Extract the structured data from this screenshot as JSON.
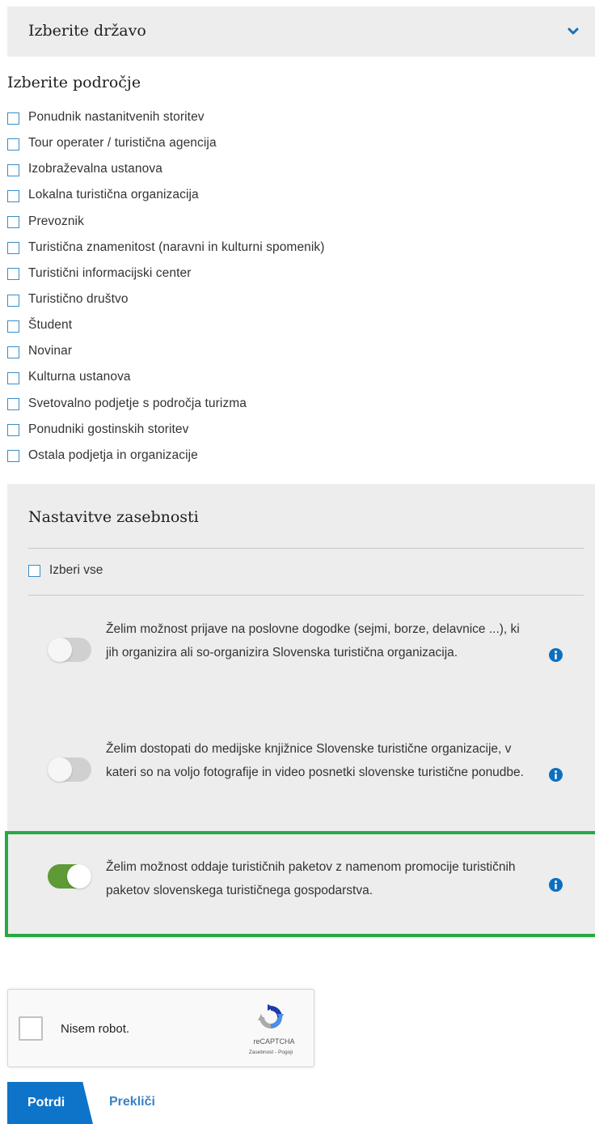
{
  "country": {
    "label": "Izberite državo",
    "icon": "chevron-down-icon"
  },
  "area": {
    "title": "Izberite področje",
    "items": [
      "Ponudnik nastanitvenih storitev",
      "Tour operater / turistična agencija",
      "Izobraževalna ustanova",
      "Lokalna turistična organizacija",
      "Prevoznik",
      "Turistična znamenitost (naravni in kulturni spomenik)",
      "Turistični informacijski center",
      "Turistično društvo",
      "Študent",
      "Novinar",
      "Kulturna ustanova",
      "Svetovalno podjetje s področja turizma",
      "Ponudniki gostinskih storitev",
      "Ostala podjetja in organizacije"
    ]
  },
  "privacy": {
    "title": "Nastavitve zasebnosti",
    "select_all": "Izberi vse",
    "consents": [
      {
        "text": "Želim možnost prijave na poslovne dogodke (sejmi, borze, delavnice ...), ki jih organizira ali so-organizira Slovenska turistična organizacija.",
        "enabled": false
      },
      {
        "text": "Želim dostopati do medijske knjižnice Slovenske turistične organizacije, v kateri so na voljo fotografije in video posnetki slovenske turistične ponudbe.",
        "enabled": false
      },
      {
        "text": "Želim možnost oddaje turističnih paketov z namenom promocije turističnih paketov slovenskega turističnega gospodarstva.",
        "enabled": true
      }
    ],
    "highlight_color": "#27a844"
  },
  "captcha": {
    "label": "Nisem robot.",
    "brand": "reCAPTCHA",
    "terms": "Zasebnost - Pogoji"
  },
  "buttons": {
    "confirm": "Potrdi",
    "cancel": "Prekliči"
  },
  "colors": {
    "accent": "#0d74c9",
    "toggle_on": "#5e9a35",
    "checkbox_border": "#3a8dc7"
  }
}
